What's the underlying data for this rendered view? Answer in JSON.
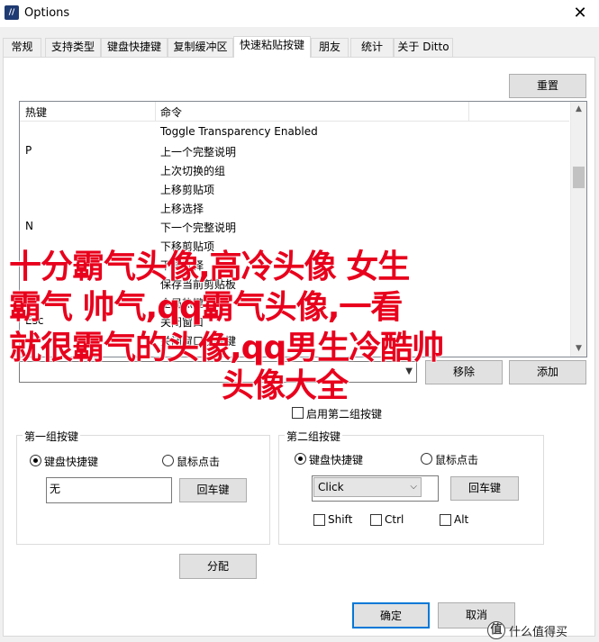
{
  "window": {
    "title": "Options",
    "icon_letter": "//",
    "close_label": "✕"
  },
  "tabs": [
    {
      "label": "常规"
    },
    {
      "label": "支持类型"
    },
    {
      "label": "键盘快捷键"
    },
    {
      "label": "复制缓冲区"
    },
    {
      "label": "快速粘贴按键",
      "active": true
    },
    {
      "label": "朋友"
    },
    {
      "label": "统计"
    },
    {
      "label": "关于 Ditto"
    }
  ],
  "reset_label": "重置",
  "table": {
    "headers": [
      "热键",
      "命令"
    ],
    "rows": [
      {
        "key": "",
        "command": "Toggle Transparency Enabled"
      },
      {
        "key": "P",
        "command": "上一个完整说明"
      },
      {
        "key": "",
        "command": "上次切换的组"
      },
      {
        "key": "",
        "command": "上移剪贴项"
      },
      {
        "key": "",
        "command": "上移选择"
      },
      {
        "key": "N",
        "command": "下一个完整说明"
      },
      {
        "key": "",
        "command": "下移剪贴项"
      },
      {
        "key": "",
        "command": "下移选择"
      },
      {
        "key": "",
        "command": "保存当前剪贴板"
      },
      {
        "key": "",
        "command": "全局热键"
      },
      {
        "key": "Esc",
        "command": "关闭窗口"
      },
      {
        "key": "",
        "command": "关闭窗口快捷键"
      }
    ]
  },
  "combo_value": "",
  "remove_label": "移除",
  "add_label": "添加",
  "enable_second_group_label": "启用第二组按键",
  "group1": {
    "title": "第一组按键",
    "radio_keyboard": "键盘快捷键",
    "radio_mouse": "鼠标点击",
    "key_value": "无",
    "enter_label": "回车键"
  },
  "group2": {
    "title": "第二组按键",
    "radio_keyboard": "键盘快捷键",
    "radio_mouse": "鼠标点击",
    "select_value": "Click",
    "enter_label": "回车键",
    "shift_label": "Shift",
    "ctrl_label": "Ctrl",
    "alt_label": "Alt"
  },
  "assign_label": "分配",
  "ok_label": "确定",
  "cancel_label": "取消",
  "overlay": {
    "line1": "十分霸气头像,高冷头像 女生",
    "line2": "霸气 帅气,qq霸气头像,一看",
    "line3": "就很霸气的头像,qq男生冷酷帅",
    "line4": "头像大全"
  },
  "watermark": {
    "logo": "值",
    "text": "什么值得买"
  },
  "colors": {
    "overlay_text": "#e8001c",
    "button_face": "#e1e1e1"
  }
}
